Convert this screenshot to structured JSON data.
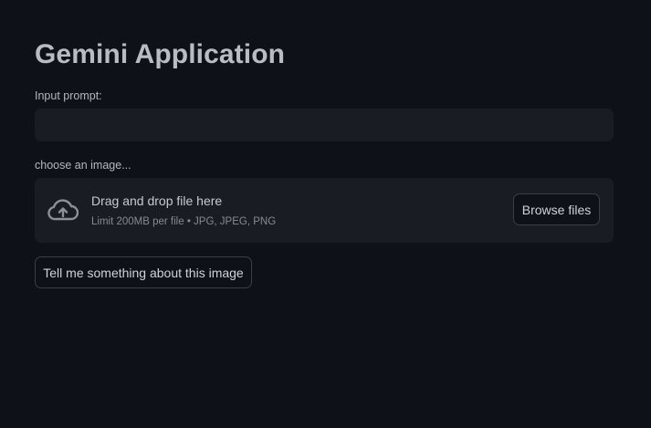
{
  "app": {
    "title": "Gemini Application"
  },
  "prompt": {
    "label": "Input prompt:",
    "value": "",
    "placeholder": ""
  },
  "image_upload": {
    "label": "choose an image...",
    "dropzone_text": "Drag and drop file here",
    "limit_text": "Limit 200MB per file • JPG, JPEG, PNG",
    "browse_label": "Browse files",
    "icon": "cloud-upload-icon"
  },
  "actions": {
    "submit_label": "Tell me something about this image"
  },
  "colors": {
    "background": "#0e1117",
    "input_background": "#1a1c24",
    "button_border": "#3b3e47"
  }
}
